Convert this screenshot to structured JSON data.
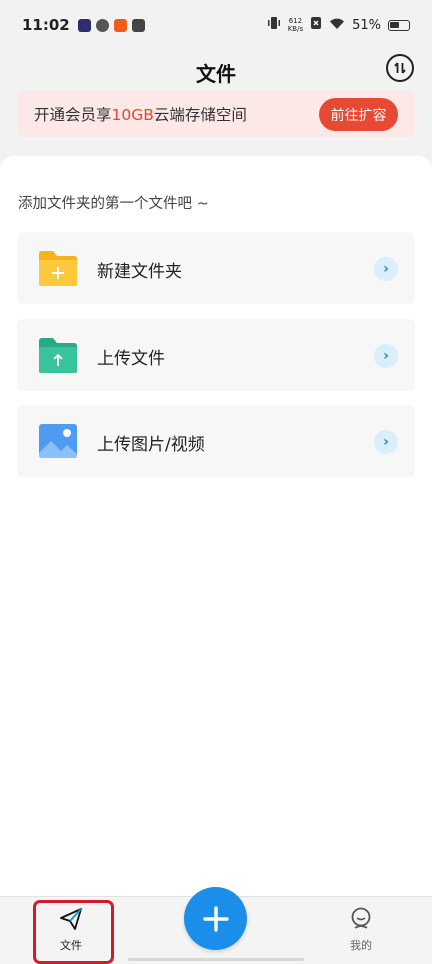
{
  "status_bar": {
    "time": "11:02",
    "net_speed_value": "612",
    "net_speed_unit": "KB/s",
    "battery": "51%"
  },
  "header": {
    "title": "文件"
  },
  "banner": {
    "text_before": "开通会员享",
    "highlight": "10GB",
    "text_after": "云端存储空间",
    "button_label": "前往扩容"
  },
  "content": {
    "hint": "添加文件夹的第一个文件吧 ~",
    "actions": [
      {
        "label": "新建文件夹",
        "icon": "new-folder-icon"
      },
      {
        "label": "上传文件",
        "icon": "upload-file-icon"
      },
      {
        "label": "上传图片/视频",
        "icon": "upload-image-icon"
      }
    ]
  },
  "bottom_nav": {
    "tabs": [
      {
        "label": "文件",
        "icon": "paper-plane-icon",
        "active": true
      },
      {
        "label": "我的",
        "icon": "profile-icon",
        "active": false
      }
    ],
    "fab_icon": "plus-icon"
  },
  "colors": {
    "accent_blue": "#1a8ee8",
    "banner_red": "#e64a33",
    "folder_yellow": "#f9b21b",
    "folder_green": "#39c39a",
    "image_blue": "#4f9bf1"
  }
}
